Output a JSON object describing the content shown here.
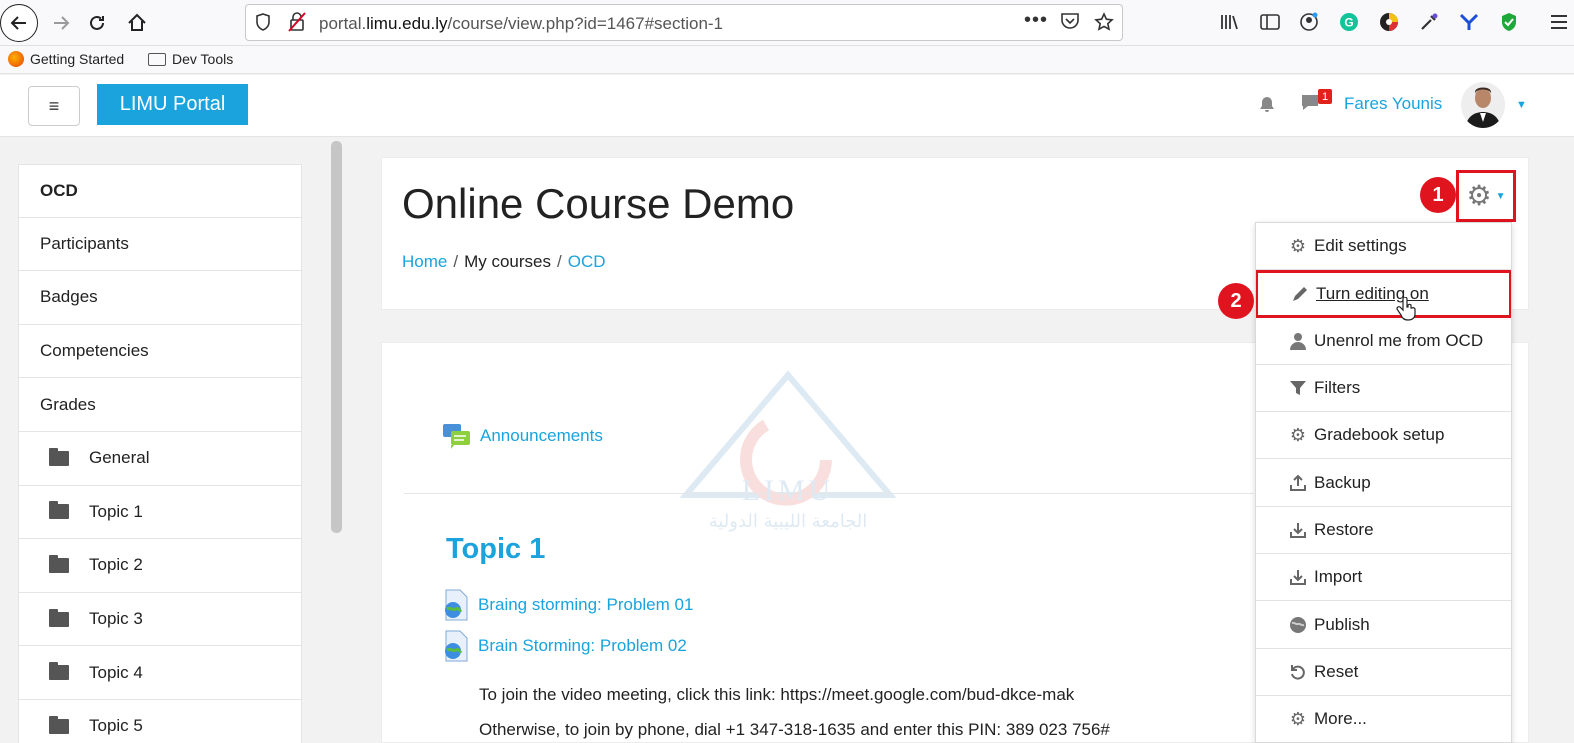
{
  "browser": {
    "url_prefix": "portal.",
    "url_domain": "limu.edu.ly",
    "url_path": "/course/view.php?id=1467#section-1",
    "bookmarks": [
      "Getting Started",
      "Dev Tools"
    ]
  },
  "navbar": {
    "menu_glyph": "≡",
    "brand": "LIMU Portal",
    "notification_count": "1",
    "user_name": "Fares Younis"
  },
  "drawer": {
    "items": [
      "OCD",
      "Participants",
      "Badges",
      "Competencies",
      "Grades"
    ],
    "sections": [
      "General",
      "Topic 1",
      "Topic 2",
      "Topic 3",
      "Topic 4",
      "Topic 5"
    ]
  },
  "header": {
    "title": "Online Course Demo",
    "breadcrumb": [
      "Home",
      "My courses",
      "OCD"
    ],
    "separator": "/"
  },
  "content": {
    "announcements": "Announcements",
    "topic_heading": "Topic 1",
    "activities": [
      "Braing storming: Problem 01",
      "Brain Storming: Problem 02"
    ],
    "meeting_text": "To join the video meeting, click this link: https://meet.google.com/bud-dkce-mak",
    "phone_text": "Otherwise, to join by phone, dial +1 347-318-1635 and enter this PIN: 389 023 756#",
    "watermark_latin": "LIMU",
    "watermark_arabic": "الجامعة الليبية الدولية"
  },
  "annotations": {
    "step1": "1",
    "step2": "2"
  },
  "admin_menu": {
    "items": [
      {
        "label": "Edit settings",
        "icon": "gear-icon"
      },
      {
        "label": "Turn editing on",
        "icon": "pencil-icon"
      },
      {
        "label": "Unenrol me from OCD",
        "icon": "user-icon"
      },
      {
        "label": "Filters",
        "icon": "filter-icon"
      },
      {
        "label": "Gradebook setup",
        "icon": "gear-icon"
      },
      {
        "label": "Backup",
        "icon": "upload-icon"
      },
      {
        "label": "Restore",
        "icon": "download-icon"
      },
      {
        "label": "Import",
        "icon": "download-icon"
      },
      {
        "label": "Publish",
        "icon": "globe-icon"
      },
      {
        "label": "Reset",
        "icon": "reset-icon"
      },
      {
        "label": "More...",
        "icon": "gear-icon"
      }
    ]
  },
  "colors": {
    "accent": "#1aa3dc",
    "highlight_red": "#e0141e",
    "badge_red": "#e0221a"
  }
}
